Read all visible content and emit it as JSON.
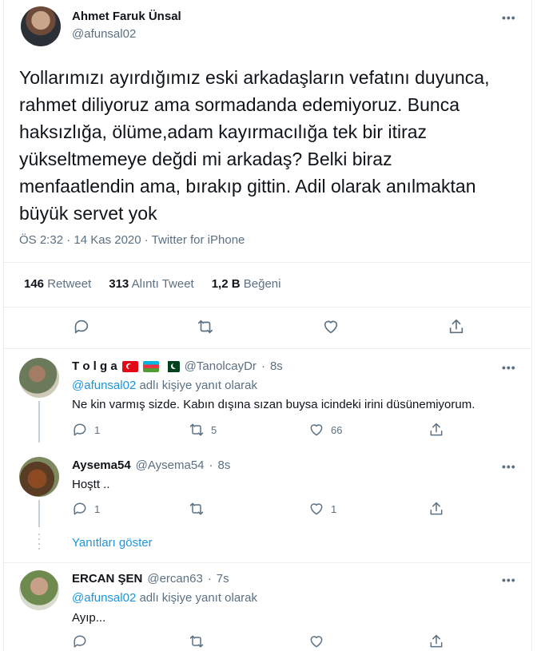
{
  "main_tweet": {
    "name": "Ahmet Faruk Ünsal",
    "handle": "@afunsal02",
    "text": "Yollarımızı ayırdığımız eski arkadaşların vefatını duyunca, rahmet diliyoruz ama sormadanda edemiyoruz. Bunca haksızlığa, ölüme,adam kayırmacılığa tek bir itiraz yükseltmemeye değdi mi arkadaş? Belki biraz menfaatlendin ama, bırakıp gittin. Adil olarak anılmaktan büyük servet yok",
    "meta": "ÖS 2:32 · 14 Kas 2020 · Twitter for iPhone",
    "stats": {
      "retweet_count": "146",
      "retweet_label": "Retweet",
      "quote_count": "313",
      "quote_label": "Alıntı Tweet",
      "like_count": "1,2 B",
      "like_label": "Beğeni"
    },
    "more": "•••"
  },
  "replies": [
    {
      "name": "T o l g a",
      "handle": "@TanolcayDr",
      "time": "8s",
      "reply_to_user": "@afunsal02",
      "reply_to_suffix": " adlı kişiye yanıt olarak",
      "text": "Ne kin varmış sizde. Kabın dışına sızan buysa icindeki irini düsünemiyorum.",
      "reply_count": "1",
      "retweet_count": "5",
      "like_count": "66"
    },
    {
      "name": "Aysema54",
      "handle": "@Aysema54",
      "time": "8s",
      "text": "Hoştt ..",
      "reply_count": "1",
      "retweet_count": "",
      "like_count": "1"
    },
    {
      "name": "ERCAN ŞEN",
      "handle": "@ercan63",
      "time": "7s",
      "reply_to_user": "@afunsal02",
      "reply_to_suffix": " adlı kişiye yanıt olarak",
      "text": "Ayıp..."
    }
  ],
  "show_replies_label": "Yanıtları göster",
  "dot": "·",
  "colors": {
    "link": "#1b95e0",
    "muted": "#5b7083",
    "text": "#0f1419"
  }
}
